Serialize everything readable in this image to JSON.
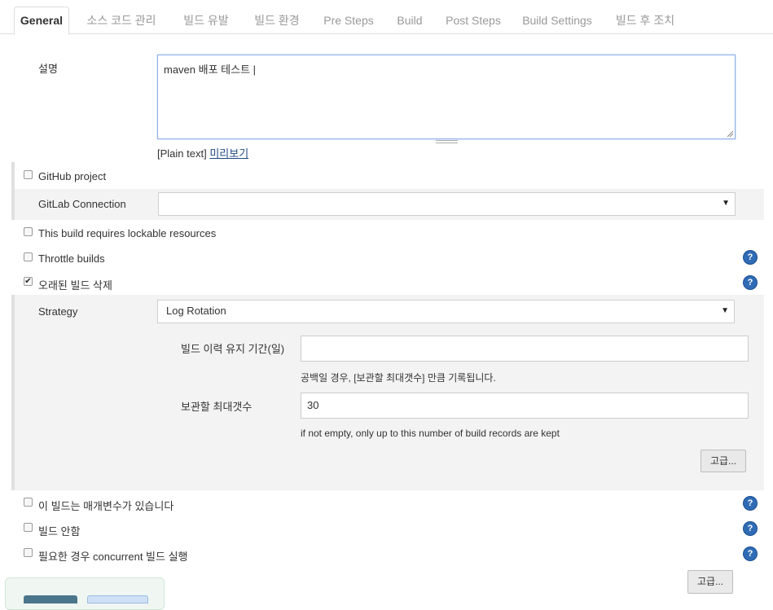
{
  "tabs": [
    {
      "label": "General",
      "active": true
    },
    {
      "label": "소스 코드 관리"
    },
    {
      "label": "빌드 유발"
    },
    {
      "label": "빌드 환경"
    },
    {
      "label": "Pre Steps"
    },
    {
      "label": "Build"
    },
    {
      "label": "Post Steps"
    },
    {
      "label": "Build Settings"
    },
    {
      "label": "빌드 후 조치"
    }
  ],
  "description": {
    "label": "설명",
    "value": "maven 배포 테스트 |",
    "format_text": "[Plain text]",
    "preview_link": "미리보기"
  },
  "options": {
    "github_project": {
      "label": "GitHub project",
      "checked": false
    },
    "gitlab_connection": {
      "label": "GitLab Connection",
      "value": ""
    },
    "lockable_resources": {
      "label": "This build requires lockable resources",
      "checked": false
    },
    "throttle_builds": {
      "label": "Throttle builds",
      "checked": false
    },
    "discard_old_builds": {
      "label": "오래된 빌드 삭제",
      "checked": true
    }
  },
  "strategy": {
    "label": "Strategy",
    "value": "Log Rotation",
    "days_to_keep": {
      "label": "빌드 이력 유지 기간(일)",
      "value": "",
      "help": "공백일 경우, [보관할 최대갯수] 만큼 기록됩니다."
    },
    "max_builds": {
      "label": "보관할 최대갯수",
      "value": "30",
      "help": "if not empty, only up to this number of build records are kept"
    },
    "advanced_label": "고급..."
  },
  "more_options": {
    "parameterized": {
      "label": "이 빌드는 매개변수가 있습니다",
      "checked": false
    },
    "disable_build": {
      "label": "빌드 안함",
      "checked": false
    },
    "concurrent": {
      "label": "필요한 경우 concurrent 빌드 실행",
      "checked": false
    },
    "advanced_label": "고급..."
  },
  "icons": {
    "help": "help-icon",
    "dropdown": "chevron-down-icon",
    "check": "checkmark"
  },
  "colors": {
    "accent": "#2f6cb5",
    "link": "#204a87",
    "focus_border": "#8fb0e8",
    "button_primary": "#4b758b",
    "button_secondary": "#cfe0f7"
  }
}
